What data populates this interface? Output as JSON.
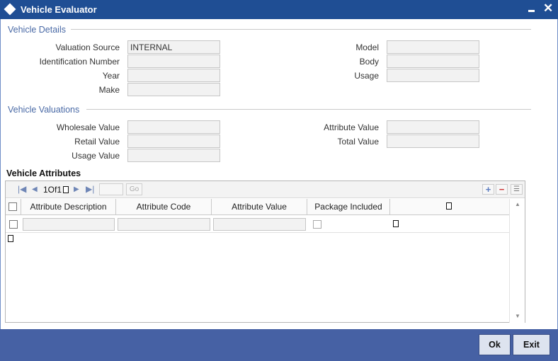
{
  "window": {
    "title": "Vehicle Evaluator",
    "minimize_label": "",
    "close_label": "✕"
  },
  "sections": {
    "details": "Vehicle Details",
    "valuations": "Vehicle Valuations",
    "attributes": "Vehicle Attributes"
  },
  "details": {
    "valuation_source": {
      "label": "Valuation Source",
      "value": "INTERNAL"
    },
    "identification_number": {
      "label": "Identification Number",
      "value": ""
    },
    "year": {
      "label": "Year",
      "value": ""
    },
    "make": {
      "label": "Make",
      "value": ""
    },
    "model": {
      "label": "Model",
      "value": ""
    },
    "body": {
      "label": "Body",
      "value": ""
    },
    "usage": {
      "label": "Usage",
      "value": ""
    }
  },
  "valuations": {
    "wholesale_value": {
      "label": "Wholesale Value",
      "value": ""
    },
    "retail_value": {
      "label": "Retail Value",
      "value": ""
    },
    "usage_value": {
      "label": "Usage Value",
      "value": ""
    },
    "attribute_value": {
      "label": "Attribute Value",
      "value": ""
    },
    "total_value": {
      "label": "Total Value",
      "value": ""
    }
  },
  "grid": {
    "pager": "1Of1",
    "go_label": "Go",
    "columns": [
      "Attribute Description",
      "Attribute Code",
      "Attribute Value",
      "Package Included"
    ]
  },
  "buttons": {
    "ok": "Ok",
    "exit": "Exit"
  }
}
